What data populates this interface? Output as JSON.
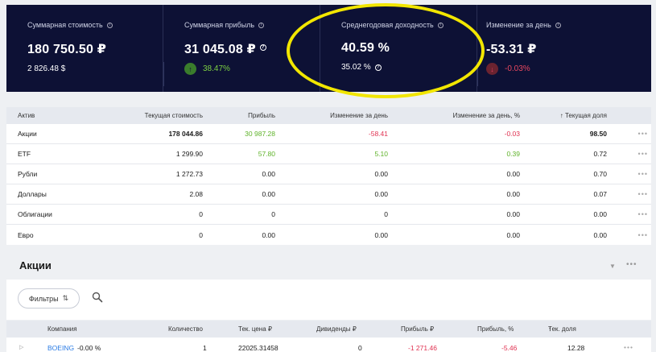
{
  "summary": {
    "cards": [
      {
        "title": "Суммарная стоимость",
        "value": "180 750.50 ₽",
        "sub": "2 826.48 $"
      },
      {
        "title": "Суммарная прибыль",
        "value": "31 045.08 ₽",
        "sub": "38.47%",
        "direction": "up"
      },
      {
        "title": "Среднегодовая доходность",
        "value": "40.59 %",
        "sub": "35.02 %"
      },
      {
        "title": "Изменение за день",
        "value": "-53.31 ₽",
        "sub": "-0.03%",
        "direction": "down"
      }
    ]
  },
  "assets": {
    "headers": [
      "Актив",
      "Текущая стоимость",
      "Прибыль",
      "Изменение за день",
      "Изменение за день, %",
      "Текущая доля"
    ],
    "rows": [
      {
        "name": "Акции",
        "value": "178 044.86",
        "profit": "30 987.28",
        "change": "-58.41",
        "change_pct": "-0.03",
        "share": "98.50"
      },
      {
        "name": "ETF",
        "value": "1 299.90",
        "profit": "57.80",
        "change": "5.10",
        "change_pct": "0.39",
        "share": "0.72"
      },
      {
        "name": "Рубли",
        "value": "1 272.73",
        "profit": "0.00",
        "change": "0.00",
        "change_pct": "0.00",
        "share": "0.70"
      },
      {
        "name": "Доллары",
        "value": "2.08",
        "profit": "0.00",
        "change": "0.00",
        "change_pct": "0.00",
        "share": "0.07"
      },
      {
        "name": "Облигации",
        "value": "0",
        "profit": "0",
        "change": "0",
        "change_pct": "0.00",
        "share": "0.00"
      },
      {
        "name": "Евро",
        "value": "0",
        "profit": "0.00",
        "change": "0.00",
        "change_pct": "0.00",
        "share": "0.00"
      }
    ],
    "more_label": "•••"
  },
  "stocks": {
    "title": "Акции",
    "filter_label": "Фильтры",
    "headers": [
      "Компания",
      "Количество",
      "Тек. цена ₽",
      "Дивиденды ₽",
      "Прибыль ₽",
      "Прибыль, %",
      "Тек. доля"
    ],
    "row": {
      "company": "BOEING",
      "day_change": "-0.00 %",
      "qty": "1",
      "price": "22025.31458",
      "dividends": "0",
      "profit": "-1 271.46",
      "profit_pct": "-5.46",
      "share": "12.28"
    }
  },
  "colors": {
    "dark_bg": "#0d1135",
    "green": "#5fb32a",
    "red": "#e03050",
    "highlight": "#f2e600"
  }
}
